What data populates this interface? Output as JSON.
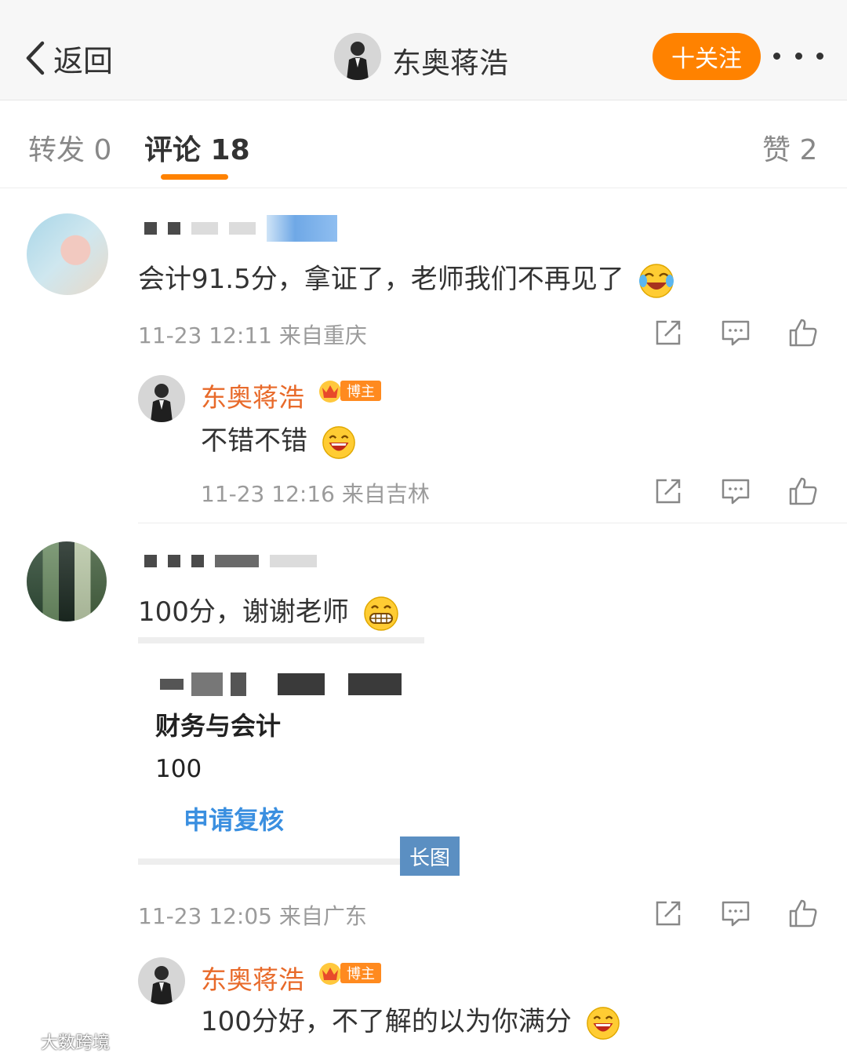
{
  "header": {
    "back_label": "返回",
    "account_name": "东奥蒋浩",
    "follow_label": "十关注"
  },
  "tabs": [
    {
      "label": "转发 0"
    },
    {
      "label": "评论 18"
    },
    {
      "label": "赞 2"
    }
  ],
  "comments": [
    {
      "text": "会计91.5分，拿证了，老师我们不再见了",
      "emoji": "laugh-cry-emoji",
      "meta": "11-23 12:11  来自重庆",
      "reply": {
        "name": "东奥蒋浩",
        "badge": "博主",
        "text": "不错不错",
        "emoji": "laugh-emoji",
        "meta": "11-23 12:16  来自吉林"
      }
    },
    {
      "text": "100分，谢谢老师",
      "emoji": "grin-emoji",
      "image": {
        "title": "财务与会计",
        "score": "100",
        "link": "申请复核",
        "tag": "长图"
      },
      "meta": "11-23 12:05  来自广东",
      "reply": {
        "name": "东奥蒋浩",
        "badge": "博主",
        "text": "100分好，不了解的以为你满分",
        "emoji": "laugh-emoji"
      }
    }
  ],
  "watermark": "大数跨境",
  "colors": {
    "accent": "#ff8200",
    "reply_name": "#e86a2a",
    "link_blue": "#3a8fe0"
  }
}
